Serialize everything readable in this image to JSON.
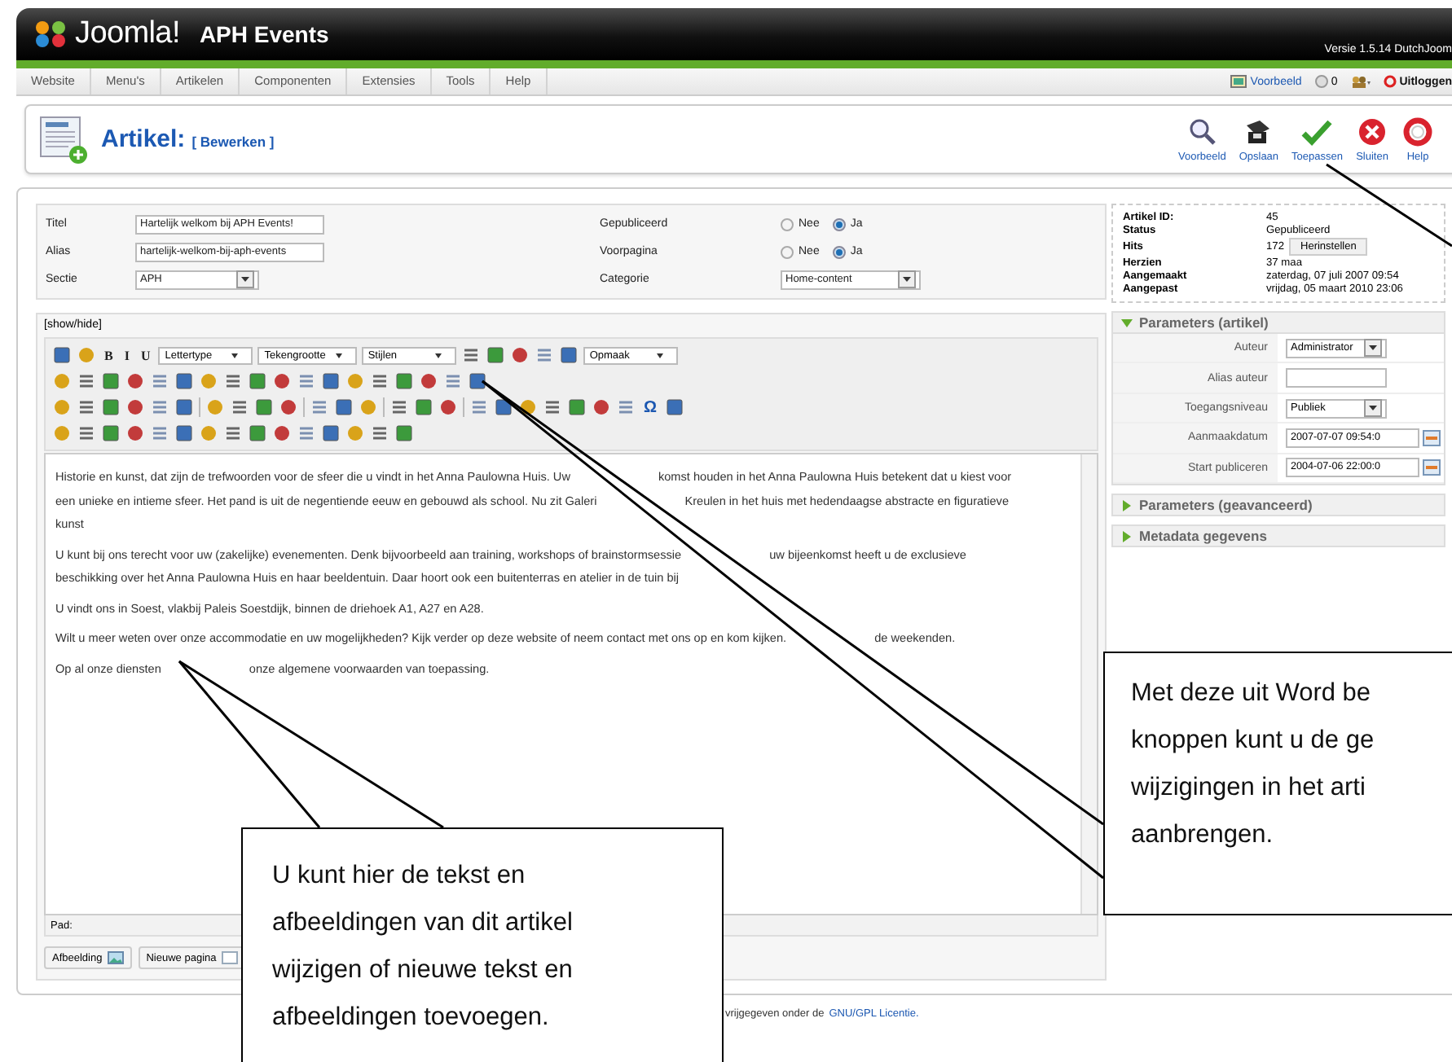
{
  "header": {
    "logo": "Joomla!",
    "site": "APH Events",
    "version": "Versie 1.5.14 DutchJoom"
  },
  "menu": [
    "Website",
    "Menu's",
    "Artikelen",
    "Componenten",
    "Extensies",
    "Tools",
    "Help"
  ],
  "status_links": [
    {
      "kind": "preview",
      "label": "Voorbeeld"
    },
    {
      "kind": "messages",
      "label": "0"
    },
    {
      "kind": "users"
    },
    {
      "kind": "logout",
      "label": "Uitloggen"
    }
  ],
  "page_title": {
    "title": "Artikel:",
    "subtitle": "[ Bewerken ]"
  },
  "toolbar": [
    {
      "kind": "preview",
      "label": "Voorbeeld"
    },
    {
      "kind": "save",
      "label": "Opslaan"
    },
    {
      "kind": "apply",
      "label": "Toepassen"
    },
    {
      "kind": "close",
      "label": "Sluiten"
    },
    {
      "kind": "help",
      "label": "Help"
    }
  ],
  "form": {
    "left": [
      {
        "label": "Titel",
        "kind": "text",
        "value": "Hartelijk welkom bij APH Events!"
      },
      {
        "label": "Alias",
        "kind": "text",
        "value": "hartelijk-welkom-bij-aph-events"
      },
      {
        "label": "Sectie",
        "kind": "select",
        "value": "APH"
      }
    ],
    "right": [
      {
        "label": "Gepubliceerd",
        "kind": "radio",
        "options": [
          {
            "label": "Nee",
            "selected": false
          },
          {
            "label": "Ja",
            "selected": true
          }
        ]
      },
      {
        "label": "Voorpagina",
        "kind": "radio",
        "options": [
          {
            "label": "Nee",
            "selected": false
          },
          {
            "label": "Ja",
            "selected": true
          }
        ]
      },
      {
        "label": "Categorie",
        "kind": "select",
        "value": "Home-content"
      }
    ]
  },
  "editor": {
    "toggle": "[show/hide]",
    "toolbar_rows": [
      [
        {
          "kind": "icon"
        },
        {
          "kind": "icon"
        },
        {
          "kind": "text",
          "label": "B"
        },
        {
          "kind": "text",
          "label": "I"
        },
        {
          "kind": "text",
          "label": "U"
        },
        {
          "kind": "select",
          "label": "Lettertype"
        },
        {
          "kind": "select",
          "label": "Tekengrootte"
        },
        {
          "kind": "select",
          "label": "Stijlen"
        },
        {
          "kind": "icon"
        },
        {
          "kind": "icon"
        },
        {
          "kind": "icon"
        },
        {
          "kind": "icon"
        },
        {
          "kind": "icon"
        },
        {
          "kind": "select",
          "label": "Opmaak"
        }
      ],
      [
        {
          "kind": "icon"
        },
        {
          "kind": "icon"
        },
        {
          "kind": "icon"
        },
        {
          "kind": "icon"
        },
        {
          "kind": "icon"
        },
        {
          "kind": "icon"
        },
        {
          "kind": "icon"
        },
        {
          "kind": "icon"
        },
        {
          "kind": "icon"
        },
        {
          "kind": "icon"
        },
        {
          "kind": "icon"
        },
        {
          "kind": "icon"
        },
        {
          "kind": "icon"
        },
        {
          "kind": "icon"
        },
        {
          "kind": "icon"
        },
        {
          "kind": "icon"
        },
        {
          "kind": "icon"
        },
        {
          "kind": "icon"
        }
      ],
      [
        {
          "kind": "icon"
        },
        {
          "kind": "icon"
        },
        {
          "kind": "icon"
        },
        {
          "kind": "icon"
        },
        {
          "kind": "icon"
        },
        {
          "kind": "icon"
        },
        {
          "kind": "sep"
        },
        {
          "kind": "icon"
        },
        {
          "kind": "icon"
        },
        {
          "kind": "icon"
        },
        {
          "kind": "icon"
        },
        {
          "kind": "sep"
        },
        {
          "kind": "icon"
        },
        {
          "kind": "icon"
        },
        {
          "kind": "icon"
        },
        {
          "kind": "sep"
        },
        {
          "kind": "icon"
        },
        {
          "kind": "icon"
        },
        {
          "kind": "icon"
        },
        {
          "kind": "sep"
        },
        {
          "kind": "icon"
        },
        {
          "kind": "icon"
        },
        {
          "kind": "icon"
        },
        {
          "kind": "icon"
        },
        {
          "kind": "icon"
        },
        {
          "kind": "icon"
        },
        {
          "kind": "icon"
        },
        {
          "kind": "text",
          "label": "Ω"
        },
        {
          "kind": "icon"
        }
      ],
      [
        {
          "kind": "icon"
        },
        {
          "kind": "icon"
        },
        {
          "kind": "icon"
        },
        {
          "kind": "icon"
        },
        {
          "kind": "icon"
        },
        {
          "kind": "icon"
        },
        {
          "kind": "icon"
        },
        {
          "kind": "icon"
        },
        {
          "kind": "icon"
        },
        {
          "kind": "icon"
        },
        {
          "kind": "icon"
        },
        {
          "kind": "icon"
        },
        {
          "kind": "icon"
        },
        {
          "kind": "icon"
        },
        {
          "kind": "icon"
        }
      ]
    ],
    "paragraphs": [
      [
        [
          "Historie en kunst, dat zijn de trefwoorden voor de sfeer die u vindt in het Anna Paulowna Huis. Uw",
          "komst houden in het Anna Paulowna Huis betekent dat u kiest voor"
        ],
        [
          "een unieke en intieme sfeer. Het pand is uit de negentiende eeuw en gebouwd als school. Nu zit Galeri",
          "Kreulen in het huis met hedendaagse abstracte en figuratieve"
        ],
        [
          "kunst"
        ]
      ],
      [
        [
          "U kunt bij ons terecht voor uw (zakelijke) evenementen. Denk bijvoorbeeld aan training, workshops of brainstormsessie",
          "uw bijeenkomst heeft u de exclusieve"
        ],
        [
          "beschikking over het Anna Paulowna Huis en haar beeldentuin. Daar hoort ook een buitenterras en atelier in de tuin bij"
        ]
      ],
      [
        [
          "U vindt ons in Soest, vlakbij Paleis Soestdijk, binnen de driehoek A1, A27 en A28."
        ]
      ],
      [
        [
          "Wilt u meer weten over onze accommodatie en uw mogelijkheden? Kijk verder op deze website of neem contact met ons op en kom kijken.",
          "de weekenden."
        ]
      ],
      [
        [
          "Op al onze diensten",
          "onze algemene voorwaarden van toepassing."
        ]
      ]
    ],
    "path_label": "Pad:",
    "buttons": [
      "Afbeelding",
      "Nieuwe pagina"
    ]
  },
  "sidebar": {
    "info": [
      {
        "label": "Artikel ID:",
        "value": "45"
      },
      {
        "label": "Status",
        "value": "Gepubliceerd"
      },
      {
        "label": "Hits",
        "value": "172",
        "button": "Herinstellen"
      },
      {
        "label": "Herzien",
        "value": "37 maa"
      },
      {
        "label": "Aangemaakt",
        "value": "zaterdag, 07 juli 2007 09:54"
      },
      {
        "label": "Aangepast",
        "value": "vrijdag, 05 maart 2010 23:06"
      }
    ],
    "panels": [
      {
        "title": "Parameters (artikel)",
        "expanded": true,
        "rows": [
          {
            "label": "Auteur",
            "kind": "select",
            "value": "Administrator"
          },
          {
            "label": "Alias auteur",
            "kind": "text"
          },
          {
            "label": "Toegangsniveau",
            "kind": "select",
            "value": "Publiek"
          },
          {
            "label": "Aanmaakdatum",
            "kind": "date",
            "value": "2007-07-07 09:54:0"
          },
          {
            "label": "Start publiceren",
            "kind": "date",
            "value": "2004-07-06 22:00:0"
          }
        ]
      },
      {
        "title": "Parameters (geavanceerd)",
        "expanded": false
      },
      {
        "title": "Metadata gegevens",
        "expanded": false
      }
    ]
  },
  "footer": {
    "text": "vrijgegeven onder de",
    "link": "GNU/GPL Licentie."
  },
  "callouts": [
    {
      "kind": "toolbar-buttons",
      "lines": [
        "Met deze uit Word be",
        "knoppen kunt u de ge",
        "wijzigingen in het arti",
        "aanbrengen."
      ]
    },
    {
      "kind": "editor-text",
      "lines": [
        "U kunt hier de tekst en",
        "afbeeldingen van dit artikel",
        "wijzigen of nieuwe tekst en",
        "afbeeldingen toevoegen."
      ]
    }
  ]
}
